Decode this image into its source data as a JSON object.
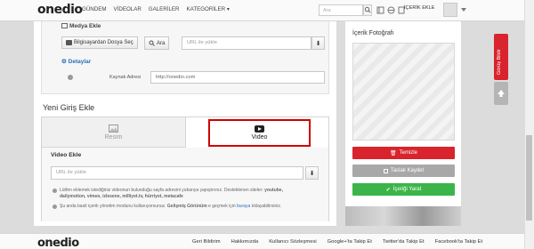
{
  "header": {
    "logo": "onedio",
    "nav": [
      "GÜNDEM",
      "VİDEOLAR",
      "GALERİLER",
      "KATEGORİLER"
    ],
    "search_placeholder": "Ara",
    "icerik_ekle": "İÇERİK EKLE"
  },
  "media": {
    "title": "Medya Ekle",
    "upload_label": "Bilgisayardan Dosya Seç",
    "search_label": "Ara",
    "url_placeholder": "URL ile yükle",
    "details_label": "Detaylar",
    "source_label": "Kaynak Adresi",
    "source_value": "http://onedio.com"
  },
  "entry": {
    "title": "Yeni Giriş Ekle",
    "tab_image": "Resim",
    "tab_video": "Video",
    "video_add": "Video Ekle",
    "video_url_placeholder": "URL ile yükle",
    "note1_pre": "Lütfen eklemek istediğiniz videonun bulunduğu sayfa adresini yukarıya yapıştırınız.  Desteklenen siteler: ",
    "note1_bold": "youtube,",
    "note1_line2": "dailymotion, vimeo, izlesene, milliyet.tv, hürriyet, metacafe",
    "note2_pre": "Şu anda basit içerik yönetim modunu kullanıyorsunuz. ",
    "note2_bold": "Gelişmiş Görünüm",
    "note2_mid": " e geçmek için ",
    "note2_link": "buraya",
    "note2_post": " tıklayabilirsiniz."
  },
  "sidebar": {
    "photo_title": "İçerik Fotoğrafı",
    "clear": "Temizle",
    "save_draft": "Taslak Kaydet",
    "create": "İçeriği Yarat"
  },
  "floating": {
    "report": "Görüş Bildir"
  },
  "footer": {
    "logo": "onedio",
    "links": [
      "Geri Bildirim",
      "Hakkımızda",
      "Kullanıcı Sözleşmesi",
      "Google+'ta Takip Et",
      "Twitter'da Takip Et",
      "Facebook'ta Takip Et"
    ]
  },
  "colors": {
    "accent_red": "#d9232d",
    "create_green": "#3bb54a",
    "link_blue": "#2a6ebb"
  }
}
